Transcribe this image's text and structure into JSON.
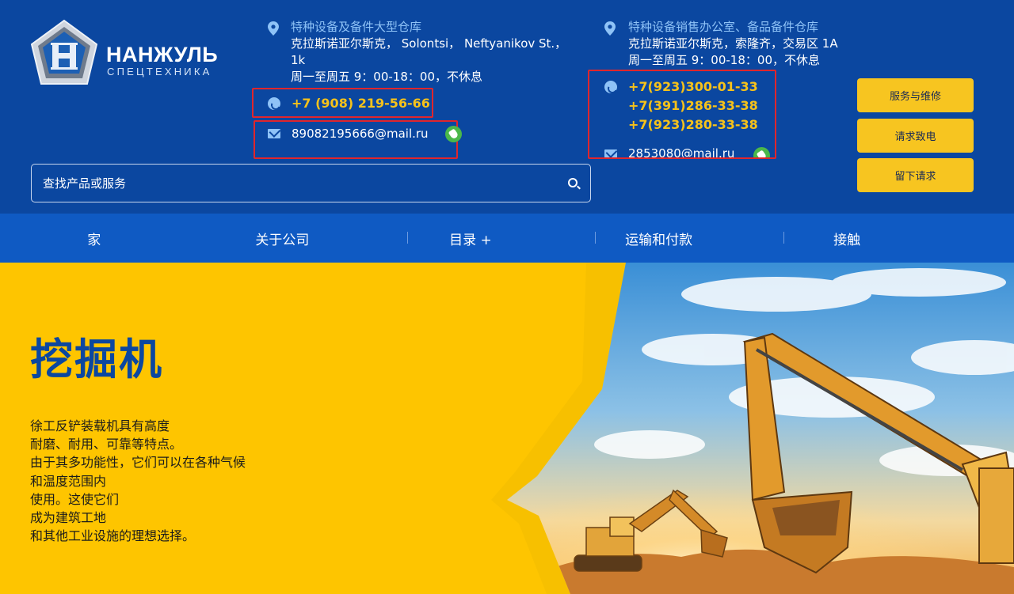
{
  "brand": {
    "name": "НАНЖУЛЬ",
    "sub": "СПЕЦТЕХНИКА",
    "badge_letter": "H",
    "colors": {
      "primary": "#0b47a0",
      "nav": "#0f5ac3",
      "accent": "#f7c520",
      "hero_bg": "#fec500"
    }
  },
  "contacts": {
    "left": {
      "title": "特种设备及备件大型仓库",
      "address_line1": "克拉斯诺亚尔斯克， Solontsi， Neftyanikov St.，",
      "address_line2": "1k",
      "hours": "周一至周五 9：00-18：00，不休息",
      "phone": "+7 (908) 219-56-66",
      "email": "89082195666@mail.ru"
    },
    "right": {
      "title": "特种设备销售办公室、备品备件仓库",
      "address": "克拉斯诺亚尔斯克，索隆齐，交易区 1A",
      "hours": "周一至周五 9：00-18：00，不休息",
      "phones": [
        "+7(923)300-01-33",
        "+7(391)286-33-38",
        "+7(923)280-33-38"
      ],
      "email": "2853080@mail.ru"
    },
    "icons": [
      "location-pin-icon",
      "phone-icon",
      "mail-icon",
      "whatsapp-icon"
    ]
  },
  "actions": {
    "service": "服务与维修",
    "callback": "请求致电",
    "request": "留下请求"
  },
  "search": {
    "placeholder": "查找产品或服务",
    "value": ""
  },
  "nav": {
    "home": "家",
    "about": "关于公司",
    "catalog": "目录 +",
    "delivery": "运输和付款",
    "contacts": "接触"
  },
  "hero": {
    "title": "挖掘机",
    "description": [
      "徐工反铲装载机具有高度",
      "耐磨、耐用、可靠等特点。",
      "由于其多功能性，它们可以在各种气候",
      "和温度范围内",
      "使用。这使它们",
      "成为建筑工地",
      "和其他工业设施的理想选择。"
    ]
  }
}
